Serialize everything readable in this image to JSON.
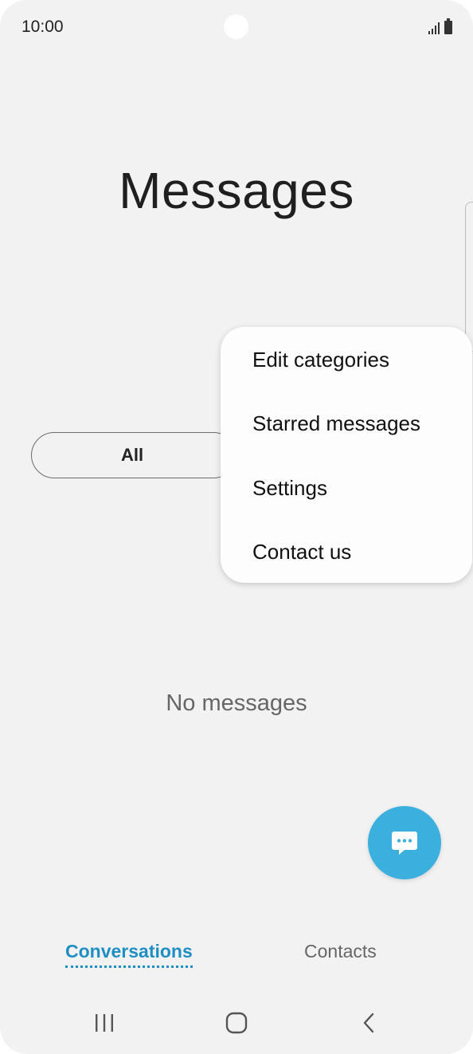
{
  "status_bar": {
    "time": "10:00",
    "signal_icon": "signal-icon",
    "battery_icon": "battery-icon"
  },
  "header": {
    "title": "Messages"
  },
  "filter": {
    "all_label": "All"
  },
  "menu": {
    "items": [
      {
        "label": "Edit categories"
      },
      {
        "label": "Starred messages"
      },
      {
        "label": "Settings"
      },
      {
        "label": "Contact us"
      }
    ]
  },
  "main": {
    "empty_text": "No messages"
  },
  "fab": {
    "icon": "compose-message-icon",
    "color": "#3bb0de"
  },
  "tabs": {
    "conversations": "Conversations",
    "contacts": "Contacts",
    "active_color": "#1e8fc4"
  },
  "nav_bar": {
    "recents_icon": "recents-icon",
    "home_icon": "home-icon",
    "back_icon": "back-icon"
  }
}
